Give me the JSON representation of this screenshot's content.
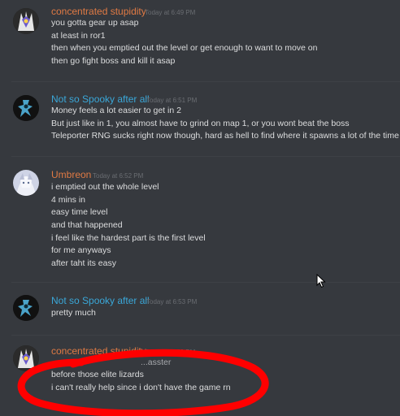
{
  "colors": {
    "background": "#36393e",
    "text": "#dcddde",
    "timestamp": "#6a6d72",
    "user_orange": "#e07a44",
    "user_blue": "#3aa7d8",
    "annotation_red": "#ff0000"
  },
  "messages": [
    {
      "username": "concentrated stupidity",
      "timestamp": "Today at 6:49 PM",
      "lines": [
        "you gotta gear up asap",
        "at least in ror1",
        "then when you emptied out the level or get enough to want to move on",
        "then go fight boss and kill it asap"
      ]
    },
    {
      "username": "Not so Spooky after all",
      "timestamp": "Today at 6:51 PM",
      "lines": [
        "Money feels a lot easier to get in 2",
        "But just like in 1, you almost have to grind on map 1, or you wont beat the boss",
        "Teleporter RNG sucks right now though, hard as hell to find where it spawns a lot of the time"
      ]
    },
    {
      "username": "Umbreon",
      "timestamp": "Today at 6:52 PM",
      "lines": [
        "i emptied out the whole level",
        "4 mins in",
        "easy time level",
        "and that happened",
        "i feel like the hardest part is the first level",
        "for me anyways",
        "after taht its easy"
      ]
    },
    {
      "username": "Not so Spooky after all",
      "timestamp": "Today at 6:53 PM",
      "lines": [
        "pretty much"
      ]
    },
    {
      "username": "concentrated stupidity",
      "timestamp": "Today at 6:53 PM",
      "partial_line": "...asster",
      "lines": [
        "before those elite lizards",
        "i can't really help since i don't have the game rn"
      ]
    }
  ]
}
